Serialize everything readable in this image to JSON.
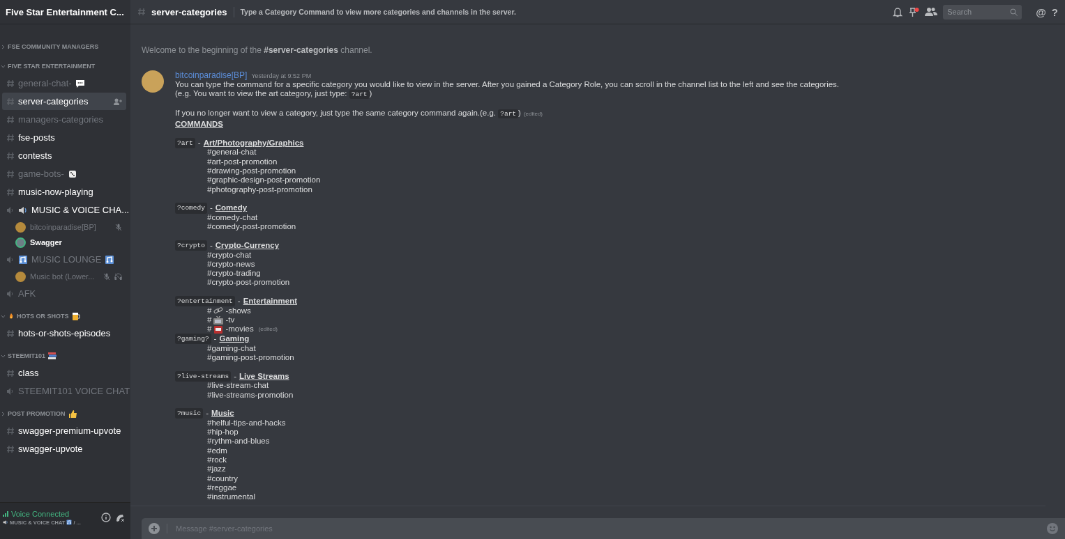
{
  "server": {
    "name": "Five Star Entertainment C..."
  },
  "sidebar": {
    "categories": [
      {
        "name": "FSE COMMUNITY MANAGERS",
        "expanded": false
      },
      {
        "name": "FIVE STAR ENTERTAINMENT",
        "expanded": true,
        "channels": [
          {
            "kind": "text",
            "name": "general-chat-",
            "post": {
              "kind": "speech"
            },
            "unread": false,
            "selected": false
          },
          {
            "kind": "text",
            "name": "server-categories",
            "unread": true,
            "selected": true
          },
          {
            "kind": "text",
            "name": "managers-categories",
            "unread": false,
            "selected": false
          },
          {
            "kind": "text",
            "name": "fse-posts",
            "unread": true,
            "selected": false
          },
          {
            "kind": "text",
            "name": "contests",
            "unread": true,
            "selected": false
          },
          {
            "kind": "text",
            "name": "game-bots-",
            "post": {
              "kind": "die"
            },
            "unread": false,
            "selected": false
          },
          {
            "kind": "text",
            "name": "music-now-playing",
            "unread": true,
            "selected": false
          },
          {
            "kind": "voice",
            "name": "MUSIC & VOICE CHA...",
            "pre": {
              "kind": "speaker"
            },
            "connected": true,
            "selected": false,
            "members": [
              {
                "name": "bitcoinparadise[BP]",
                "speaking": false,
                "muted": true,
                "deafened": false
              },
              {
                "name": "Swagger",
                "speaking": true,
                "muted": false,
                "deafened": false
              }
            ]
          },
          {
            "kind": "voice",
            "name": "MUSIC LOUNGE",
            "pre": {
              "kind": "notes"
            },
            "post": {
              "kind": "notes"
            },
            "connected": false,
            "selected": false,
            "members": [
              {
                "name": "Music bot (Lower...",
                "speaking": false,
                "muted": true,
                "deafened": true
              }
            ]
          },
          {
            "kind": "voice",
            "name": "AFK",
            "connected": false,
            "selected": false
          }
        ]
      },
      {
        "name": "HOTS OR SHOTS",
        "pre": {
          "kind": "fire"
        },
        "post": {
          "kind": "beer"
        },
        "expanded": true,
        "channels": [
          {
            "kind": "text",
            "name": "hots-or-shots-episodes",
            "unread": true,
            "selected": false
          }
        ]
      },
      {
        "name": "STEEMIT101",
        "post": {
          "kind": "books"
        },
        "expanded": true,
        "channels": [
          {
            "kind": "text",
            "name": "class",
            "unread": true,
            "selected": false
          },
          {
            "kind": "voice",
            "name": "STEEMIT101 VOICE CHAT",
            "connected": false,
            "selected": false
          }
        ]
      },
      {
        "name": "POST PROMOTION",
        "post": {
          "kind": "thumb"
        },
        "expanded": false,
        "channels": [
          {
            "kind": "text",
            "name": "swagger-premium-upvote",
            "unread": true,
            "selected": false
          },
          {
            "kind": "text",
            "name": "swagger-upvote",
            "unread": true,
            "selected": false
          }
        ]
      }
    ]
  },
  "voice_panel": {
    "status": "Voice Connected",
    "channel": "MUSIC & VOICE CHAT",
    "channel_pre": {
      "kind": "speaker"
    },
    "channel_post": {
      "kind": "notes"
    },
    "suffix": "/ ..."
  },
  "header": {
    "channel": "server-categories",
    "topic": "Type a Category Command to view more categories and channels in the server.",
    "pin_unread": true,
    "search": {
      "placeholder": "Search"
    },
    "mention_glyph": "@",
    "help_glyph": "?"
  },
  "welcome": "Welcome to the beginning of the **#server-categories** channel.",
  "message": {
    "author": "bitcoinparadise[BP]",
    "time": "Yesterday at 9:52 PM",
    "lines": [
      {
        "spaced": false,
        "parts": [
          {
            "kind": "text",
            "text": "You can type the command for a specific category you would like to view in the server. After you gained a Category Role, you can scroll in the channel list to the left and see the categories."
          }
        ]
      },
      {
        "spaced": false,
        "parts": [
          {
            "kind": "text",
            "text": "(e.g. You want to view the art category, just type: "
          },
          {
            "kind": "code",
            "text": "?art"
          },
          {
            "kind": "text",
            "text": ")"
          }
        ]
      },
      {
        "spaced": true,
        "parts": [
          {
            "kind": "text",
            "text": "If you no longer want to view a category, just type the same category command again.(e.g. "
          },
          {
            "kind": "code",
            "text": "?art"
          },
          {
            "kind": "text",
            "text": ")"
          },
          {
            "kind": "edited",
            "text": "(edited)"
          }
        ]
      }
    ],
    "heading": "COMMANDS",
    "groups": [
      {
        "command": "?art",
        "dash": "-",
        "title": "Art/Photography/Graphics",
        "spaced": true,
        "channels": [
          {
            "text": "#general-chat"
          },
          {
            "text": "#art-post-promotion"
          },
          {
            "text": "#drawing-post-promotion"
          },
          {
            "text": "#graphic-design-post-promotion"
          },
          {
            "text": "#photography-post-promotion"
          }
        ]
      },
      {
        "command": "?comedy",
        "dash": "-",
        "title": "Comedy",
        "spaced": true,
        "channels": [
          {
            "text": "#comedy-chat"
          },
          {
            "text": "#comedy-post-promotion"
          }
        ]
      },
      {
        "command": "?crypto",
        "dash": "-",
        "title": "Crypto-Currency",
        "spaced": true,
        "channels": [
          {
            "text": "#crypto-chat"
          },
          {
            "text": "#crypto-news"
          },
          {
            "text": "#crypto-trading"
          },
          {
            "text": "#crypto-post-promotion"
          }
        ]
      },
      {
        "command": "?entertainment",
        "dash": "-",
        "title": "Entertainment",
        "spaced": true,
        "channels": [
          {
            "hash": "#",
            "badge": {
              "kind": "chain"
            },
            "text": "-shows"
          },
          {
            "hash": "#",
            "badge": {
              "kind": "tv"
            },
            "text": "-tv"
          },
          {
            "hash": "#",
            "badge": {
              "kind": "screen"
            },
            "text": "-movies",
            "edited": "(edited)"
          }
        ]
      },
      {
        "command": "?gaming?",
        "dash": "-",
        "title": "Gaming",
        "spaced": false,
        "channels": [
          {
            "text": "#gaming-chat"
          },
          {
            "text": "#gaming-post-promotion"
          }
        ]
      },
      {
        "command": "?live-streams",
        "dash": "-",
        "title": "Live Streams",
        "spaced": true,
        "channels": [
          {
            "text": "#live-stream-chat"
          },
          {
            "text": "#live-streams-promotion"
          }
        ]
      },
      {
        "command": "?music",
        "dash": "-",
        "title": "Music",
        "spaced": true,
        "channels": [
          {
            "text": "#helful-tips-and-hacks"
          },
          {
            "text": "#hip-hop"
          },
          {
            "text": "#rythm-and-blues"
          },
          {
            "text": "#edm"
          },
          {
            "text": "#rock"
          },
          {
            "text": "#jazz"
          },
          {
            "text": "#country"
          },
          {
            "text": "#reggae"
          },
          {
            "text": "#instrumental"
          }
        ]
      }
    ]
  },
  "composer": {
    "placeholder": "Message #server-categories"
  }
}
